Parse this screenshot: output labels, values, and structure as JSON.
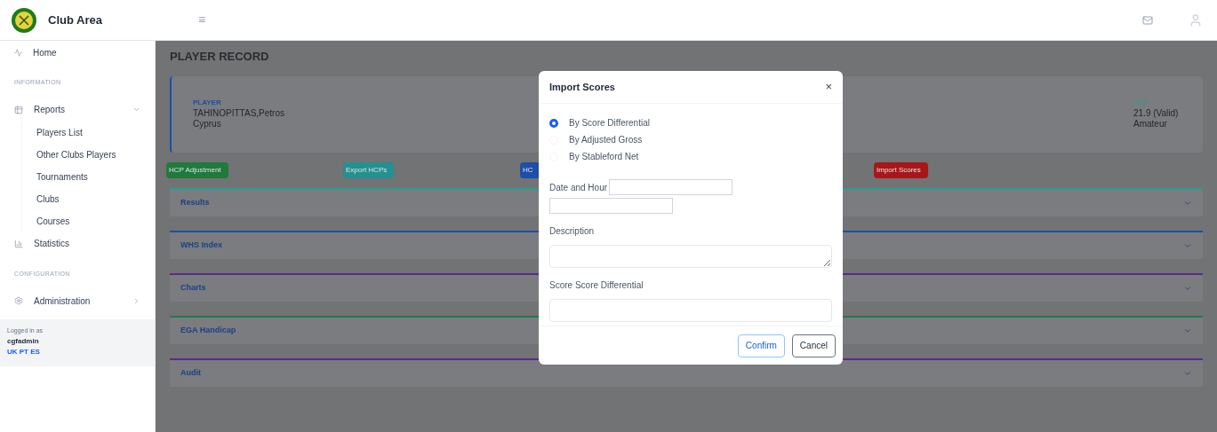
{
  "header": {
    "title": "Club Area",
    "menu_glyph": "≡"
  },
  "sidebar": {
    "home": "Home",
    "sections": [
      {
        "title": "INFORMATION",
        "items": [
          {
            "label": "Reports",
            "expanded": true,
            "children": [
              {
                "label": "Players List"
              },
              {
                "label": "Other Clubs Players"
              },
              {
                "label": "Tournaments"
              },
              {
                "label": "Clubs"
              },
              {
                "label": "Courses"
              }
            ]
          },
          {
            "label": "Statistics"
          }
        ]
      },
      {
        "title": "CONFIGURATION",
        "items": [
          {
            "label": "Administration",
            "expanded": false
          }
        ]
      }
    ],
    "login": {
      "caption": "Logged in as",
      "user": "cgfadmin",
      "languages": "UK PT ES"
    }
  },
  "page": {
    "title": "PLAYER RECORD",
    "player": {
      "label": "PLAYER",
      "name": "TAHINOPITTAS,Petros",
      "country": "Cyprus"
    },
    "hcp": {
      "label": "HCP",
      "value": "21.9 (Valid)",
      "status": "Amateur"
    },
    "buttons": [
      {
        "label": "HCP Adjustment",
        "color": "#1f7a3c"
      },
      {
        "label": "Export HCPs",
        "color": "#23918f"
      },
      {
        "label": "HC",
        "color": "#1d4ea8"
      },
      {
        "label": "Import Scores",
        "color": "#a8161a"
      }
    ],
    "sections": [
      {
        "title": "Results",
        "color": "#2a9d93"
      },
      {
        "title": "WHS Index",
        "color": "#1d4ea8"
      },
      {
        "title": "Charts",
        "color": "#5b2a8c"
      },
      {
        "title": "EGA Handicap",
        "color": "#1f7a4c"
      },
      {
        "title": "Audit",
        "color": "#5b2a8c"
      }
    ]
  },
  "dialog": {
    "title": "Import Scores",
    "close": "×",
    "options": [
      {
        "label": "By Score Differential",
        "selected": true
      },
      {
        "label": "By Adjusted Gross",
        "selected": false
      },
      {
        "label": "By Stableford Net",
        "selected": false
      }
    ],
    "date_label": "Date and Hour",
    "description_label": "Description",
    "score_label": "Score Score Differential",
    "buttons": [
      {
        "label": "Confirm",
        "kind": "primary"
      },
      {
        "label": "Cancel",
        "kind": "secondary"
      }
    ]
  }
}
